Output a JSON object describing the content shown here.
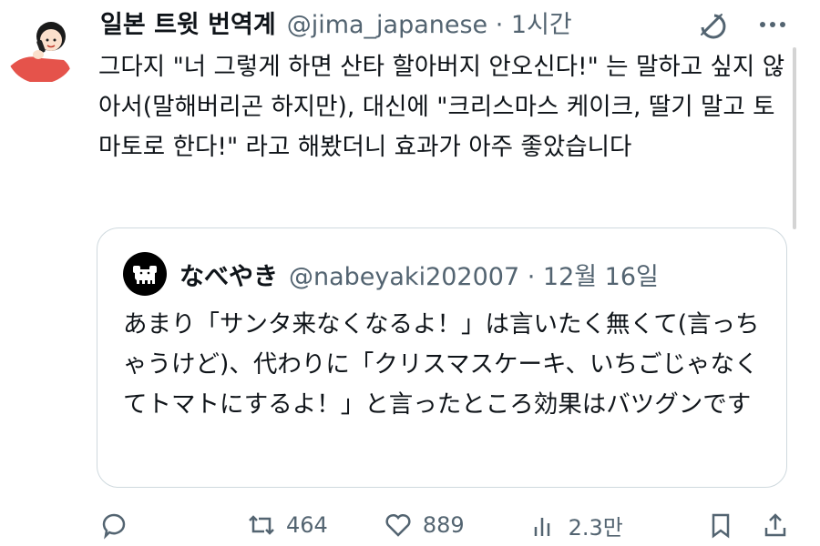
{
  "tweet": {
    "display_name": "일본 트윗 번역계",
    "handle_meta": "@jima_japanese · 1시간",
    "text": "그다지 \"너 그렇게 하면 산타 할아버지 안오신다!\" 는 말하고 싶지 않아서(말해버리곤 하지만), 대신에 \"크리스마스 케이크, 딸기 말고 토마토로 한다!\" 라고 해봤더니 효과가 아주 좋았습니다"
  },
  "quote": {
    "display_name": "なべやき",
    "handle_meta": "@nabeyaki202007 · 12월 16일",
    "text": "あまり「サンタ来なくなるよ！」は言いたく無くて(言っちゃうけど)、代わりに「クリスマスケーキ、いちごじゃなくてトマトにするよ！」と言ったところ効果はバツグンです"
  },
  "actions": {
    "reply_count": "",
    "retweet_count": "464",
    "like_count": "889",
    "views_count": "2.3만"
  },
  "icons": {
    "grok": "grok-icon",
    "more": "more-icon",
    "reply": "reply-icon",
    "retweet": "retweet-icon",
    "like": "heart-icon",
    "views": "views-icon",
    "bookmark": "bookmark-icon",
    "share": "share-icon"
  },
  "colors": {
    "text": "#0f1419",
    "secondary": "#536471",
    "border": "#cfd9de"
  }
}
